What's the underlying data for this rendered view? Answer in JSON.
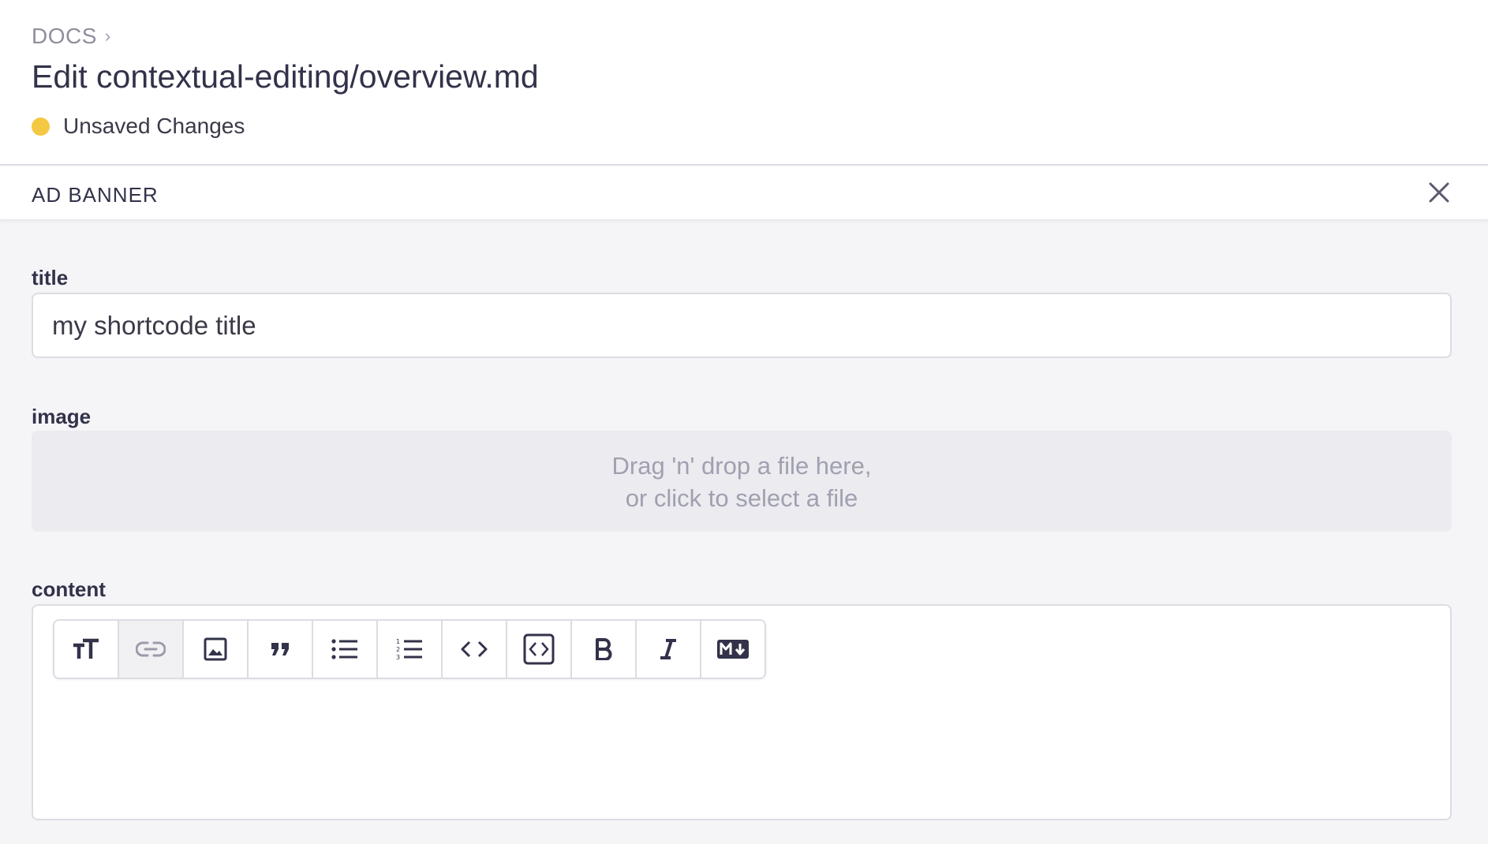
{
  "header": {
    "breadcrumb": "DOCS",
    "breadcrumb_separator": "›",
    "title": "Edit contextual-editing/overview.md",
    "status_text": "Unsaved Changes",
    "status_color": "#f4c842"
  },
  "panel": {
    "title": "AD BANNER",
    "close_icon": "close-icon"
  },
  "form": {
    "title_label": "title",
    "title_value": "my shortcode title",
    "image_label": "image",
    "dropzone_line1": "Drag 'n' drop a file here,",
    "dropzone_line2": "or click to select a file",
    "content_label": "content"
  },
  "toolbar": {
    "buttons": [
      {
        "icon": "text-size-icon",
        "label": "Heading"
      },
      {
        "icon": "link-icon",
        "label": "Link",
        "active": true
      },
      {
        "icon": "image-icon",
        "label": "Image"
      },
      {
        "icon": "quote-icon",
        "label": "Quote"
      },
      {
        "icon": "bulleted-list-icon",
        "label": "Bulleted list"
      },
      {
        "icon": "numbered-list-icon",
        "label": "Numbered list"
      },
      {
        "icon": "code-icon",
        "label": "Code"
      },
      {
        "icon": "code-block-icon",
        "label": "Code block"
      },
      {
        "icon": "bold-icon",
        "label": "Bold"
      },
      {
        "icon": "italic-icon",
        "label": "Italic"
      },
      {
        "icon": "markdown-icon",
        "label": "Markdown"
      }
    ]
  },
  "colors": {
    "accent_status": "#f4c842",
    "text_primary": "#32324a",
    "border": "#dcdce4",
    "background": "#f5f5f8"
  }
}
